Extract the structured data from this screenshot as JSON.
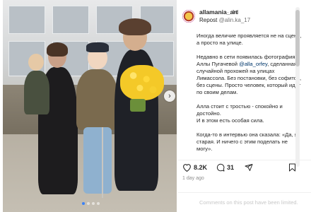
{
  "post": {
    "username": "allamania_art",
    "separator": "·",
    "age": "1d",
    "repost_prefix": "Repost",
    "repost_source": "@alin.ka_17",
    "caption_paragraphs": [
      [
        "Иногда величие проявляется не на сцене, а просто на улице."
      ],
      [
        "Недавно в сети появилась фотография Аллы Пугачевой ",
        "@alla_orfey",
        ", сделанная случайной прохожей на улицах Лимассола. Без постановки, без софитов, без сцены. Просто человек, который идёт по своим делам."
      ],
      [
        "Алла стоит с тростью - спокойно и достойно."
      ],
      [
        "И в этом есть особая сила."
      ],
      [
        "Когда-то в интервью она сказала: «Да, я старая. И ничего с этим поделать не могу»."
      ]
    ],
    "likes": "8.2K",
    "comments": "31",
    "time_ago": "1 day ago",
    "comments_limited_text": "Comments on this post have been limited.",
    "icons": {
      "like": "heart-icon",
      "comment": "comment-bubble-icon",
      "share": "send-icon",
      "save": "bookmark-icon",
      "next": "chevron-right-icon"
    }
  }
}
